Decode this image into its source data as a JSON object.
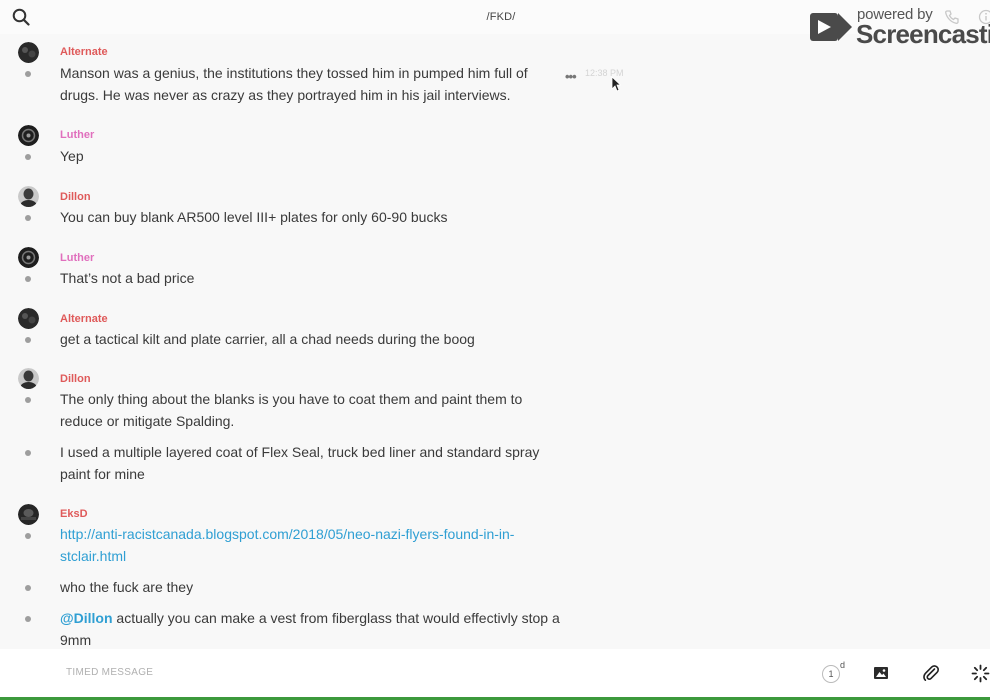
{
  "header": {
    "channel_title": "/FKD/"
  },
  "watermark": {
    "powered": "powered by",
    "brand": "Screencastify"
  },
  "messages": [
    {
      "author": "Alternate",
      "author_color": "#df5a5a",
      "text": "Manson was a genius, the institutions they tossed him in pumped him full of drugs. He was never as crazy as they portrayed him in his jail interviews.",
      "time": "12:38 PM"
    },
    {
      "author": "Luther",
      "author_color": "#e06fbd",
      "text": "Yep"
    },
    {
      "author": "Dillon",
      "author_color": "#df5a5a",
      "text": "You can buy blank AR500 level III+ plates for only 60-90 bucks"
    },
    {
      "author": "Luther",
      "author_color": "#e06fbd",
      "text": "That’s not a bad price"
    },
    {
      "author": "Alternate",
      "author_color": "#df5a5a",
      "text": "get a tactical kilt and plate carrier, all a chad needs during the boog"
    },
    {
      "author": "Dillon",
      "author_color": "#df5a5a",
      "text": "The only thing about the blanks is you have to coat them and paint them to reduce or mitigate Spalding."
    },
    {
      "text": "I used a multiple layered coat of Flex Seal, truck bed liner and standard spray paint for mine"
    },
    {
      "author": "EksD",
      "author_color": "#df5a5a",
      "link": "http://anti-racistcanada.blogspot.com/2018/05/neo-nazi-flyers-found-in-in-stclair.html"
    },
    {
      "text": "who the fuck are they"
    },
    {
      "mention": "@Dillon",
      "text": " actually you can make a vest from fiberglass that would effectivly stop a 9mm"
    }
  ],
  "composer": {
    "placeholder": "TIMED MESSAGE",
    "timer_value": "1",
    "timer_unit": "d"
  }
}
